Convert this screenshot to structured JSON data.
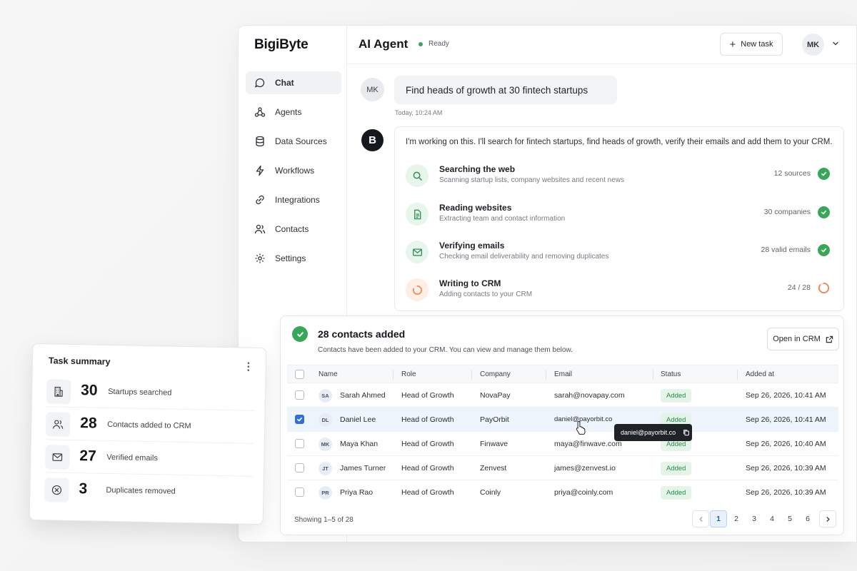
{
  "app": {
    "brand": "BigiByte"
  },
  "sidebar": {
    "items": [
      {
        "label": "Chat",
        "icon": "chat-icon",
        "active": true
      },
      {
        "label": "Agents",
        "icon": "agents-icon"
      },
      {
        "label": "Data Sources",
        "icon": "database-icon"
      },
      {
        "label": "Workflows",
        "icon": "lightning-icon"
      },
      {
        "label": "Integrations",
        "icon": "link-icon"
      },
      {
        "label": "Contacts",
        "icon": "users-icon"
      },
      {
        "label": "Settings",
        "icon": "gear-icon"
      }
    ]
  },
  "header": {
    "title": "AI Agent",
    "status": "Ready",
    "status_color": "#3aa65c",
    "new_task_label": "New task",
    "user_initials": "MK"
  },
  "chat": {
    "user_initials": "MK",
    "user_message": "Find heads of growth at 30 fintech startups",
    "timestamp": "Today, 10:24 AM",
    "agent_initial": "B",
    "agent_message": "I'm working on this. I'll search for fintech startups, find heads of growth, verify their emails and add them to your CRM.",
    "steps": [
      {
        "title": "Searching the web",
        "subtitle": "Scanning startup lists, company websites and recent news",
        "meta": "12 sources",
        "icon": "search-icon",
        "state": "done"
      },
      {
        "title": "Reading websites",
        "subtitle": "Extracting team and contact information",
        "meta": "30 companies",
        "icon": "document-icon",
        "state": "done"
      },
      {
        "title": "Verifying emails",
        "subtitle": "Checking email deliverability and removing duplicates",
        "meta": "28 valid emails",
        "icon": "mail-icon",
        "state": "done"
      },
      {
        "title": "Writing to CRM",
        "subtitle": "Adding contacts to your CRM",
        "meta": "24 / 28",
        "icon": "progress-ring-icon",
        "state": "in-progress",
        "progress": 0.857
      }
    ]
  },
  "contacts_panel": {
    "title": "28 contacts added",
    "subtitle": "Contacts have been added to your CRM. You can view and manage them below.",
    "open_crm_label": "Open in CRM",
    "columns": [
      "Name",
      "Role",
      "Company",
      "Email",
      "Status",
      "Added at"
    ],
    "rows": [
      {
        "initials": "SA",
        "name": "Sarah Ahmed",
        "role": "Head of Growth",
        "company": "NovaPay",
        "email": "sarah@novapay.com",
        "status": "Added",
        "added_at": "Sep 26, 2026, 10:41 AM",
        "selected": false
      },
      {
        "initials": "DL",
        "name": "Daniel Lee",
        "role": "Head of Growth",
        "company": "PayOrbit",
        "email": "daniel@payorbit.co",
        "status": "Added",
        "added_at": "Sep 26, 2026, 10:41 AM",
        "selected": true
      },
      {
        "initials": "MK",
        "name": "Maya Khan",
        "role": "Head of Growth",
        "company": "Finwave",
        "email": "maya@finwave.com",
        "status": "Added",
        "added_at": "Sep 26, 2026, 10:40 AM",
        "selected": false
      },
      {
        "initials": "JT",
        "name": "James Turner",
        "role": "Head of Growth",
        "company": "Zenvest",
        "email": "james@zenvest.io",
        "status": "Added",
        "added_at": "Sep 26, 2026, 10:39 AM",
        "selected": false
      },
      {
        "initials": "PR",
        "name": "Priya Rao",
        "role": "Head of Growth",
        "company": "Coinly",
        "email": "priya@coinly.com",
        "status": "Added",
        "added_at": "Sep 26, 2026, 10:39 AM",
        "selected": false
      }
    ],
    "tooltip_text": "daniel@payorbit.co",
    "showing": "Showing 1–5 of 28",
    "pages": [
      "1",
      "2",
      "3",
      "4",
      "5",
      "6"
    ],
    "current_page": "1",
    "status_colors": {
      "badge_bg": "#e4f4e8",
      "badge_text": "#2a8a49"
    }
  },
  "task_summary": {
    "title": "Task summary",
    "items": [
      {
        "value": "30",
        "label": "Startups searched",
        "icon": "building-icon"
      },
      {
        "value": "28",
        "label": "Contacts added to CRM",
        "icon": "users-icon"
      },
      {
        "value": "27",
        "label": "Verified emails",
        "icon": "mail-icon"
      },
      {
        "value": "3",
        "label": "Duplicates removed",
        "icon": "x-circle-icon"
      }
    ]
  },
  "colors": {
    "accent_green": "#3aa65c",
    "accent_blue": "#2f6fd6",
    "progress_orange": "#f0895a"
  }
}
